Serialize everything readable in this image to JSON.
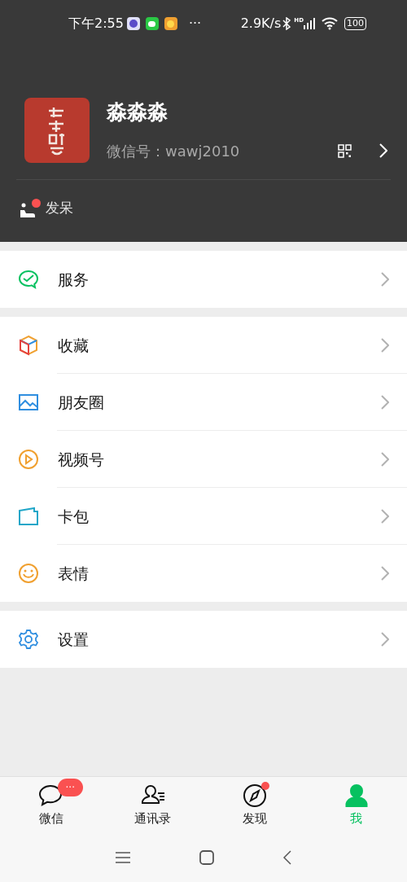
{
  "status_bar": {
    "time": "下午2:55",
    "more": "···",
    "speed": "2.9K/s",
    "network": "HD",
    "battery": "100"
  },
  "profile": {
    "name": "淼淼淼",
    "wechat_id": "微信号：wawj2010",
    "status": {
      "label": "发呆",
      "dot": true
    }
  },
  "groups": [
    [
      {
        "kind": "services",
        "label": "服务"
      }
    ],
    [
      {
        "kind": "favorites",
        "label": "收藏"
      },
      {
        "kind": "moments",
        "label": "朋友圈"
      },
      {
        "kind": "channels",
        "label": "视频号"
      },
      {
        "kind": "cards",
        "label": "卡包"
      },
      {
        "kind": "stickers",
        "label": "表情"
      }
    ],
    [
      {
        "kind": "settings",
        "label": "设置"
      }
    ]
  ],
  "tab_bar": [
    {
      "kind": "chats",
      "label": "微信",
      "selected": false,
      "badge": "···",
      "dot": false
    },
    {
      "kind": "contacts",
      "label": "通讯录",
      "selected": false,
      "dot": false
    },
    {
      "kind": "discover",
      "label": "发现",
      "selected": false,
      "dot": true
    },
    {
      "kind": "me",
      "label": "我",
      "selected": true,
      "dot": false
    }
  ]
}
